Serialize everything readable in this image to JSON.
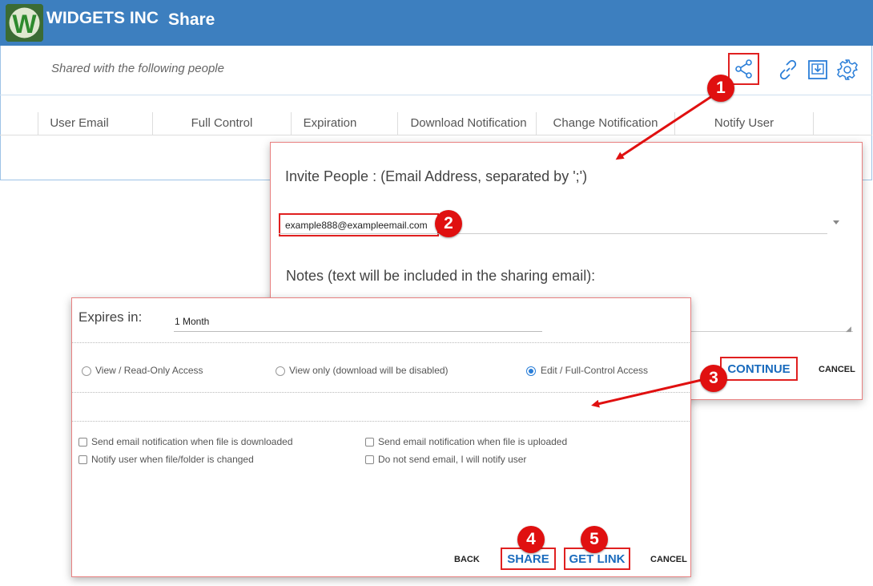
{
  "header": {
    "brand": "WIDGETS INC",
    "title": "Share",
    "logo_letter": "W",
    "bg_color": "#3d7fbf"
  },
  "panel": {
    "shared_text": "Shared with the following people",
    "icons": [
      "share-icon",
      "link-icon",
      "download-box-icon",
      "gear-icon"
    ],
    "columns": [
      "User Email",
      "Full Control",
      "Expiration",
      "Download Notification",
      "Change Notification",
      "Notify User"
    ]
  },
  "invite_dialog": {
    "invite_label": "Invite People : (Email Address, separated by ';')",
    "email_value": "example888@exampleemail.com",
    "notes_label": "Notes (text will be included in the sharing email):",
    "continue_label": "CONTINUE",
    "cancel_label": "CANCEL"
  },
  "share_dialog": {
    "expires_label": "Expires in:",
    "expires_value": "1 Month",
    "access_options": [
      {
        "label": "View / Read-Only Access",
        "selected": false
      },
      {
        "label": "View only (download will be disabled)",
        "selected": false
      },
      {
        "label": "Edit / Full-Control Access",
        "selected": true
      }
    ],
    "notifications": [
      "Send email notification when file is downloaded",
      "Send email notification when file is uploaded",
      "Notify user when file/folder is changed",
      "Do not send email, I will notify user"
    ],
    "back_label": "BACK",
    "share_label": "SHARE",
    "get_link_label": "GET LINK",
    "cancel_label": "CANCEL"
  },
  "callouts": [
    "1",
    "2",
    "3",
    "4",
    "5"
  ],
  "colors": {
    "accent": "#1a6bbd",
    "highlight": "#e02020",
    "radio_selected": "#2a7ed8"
  }
}
